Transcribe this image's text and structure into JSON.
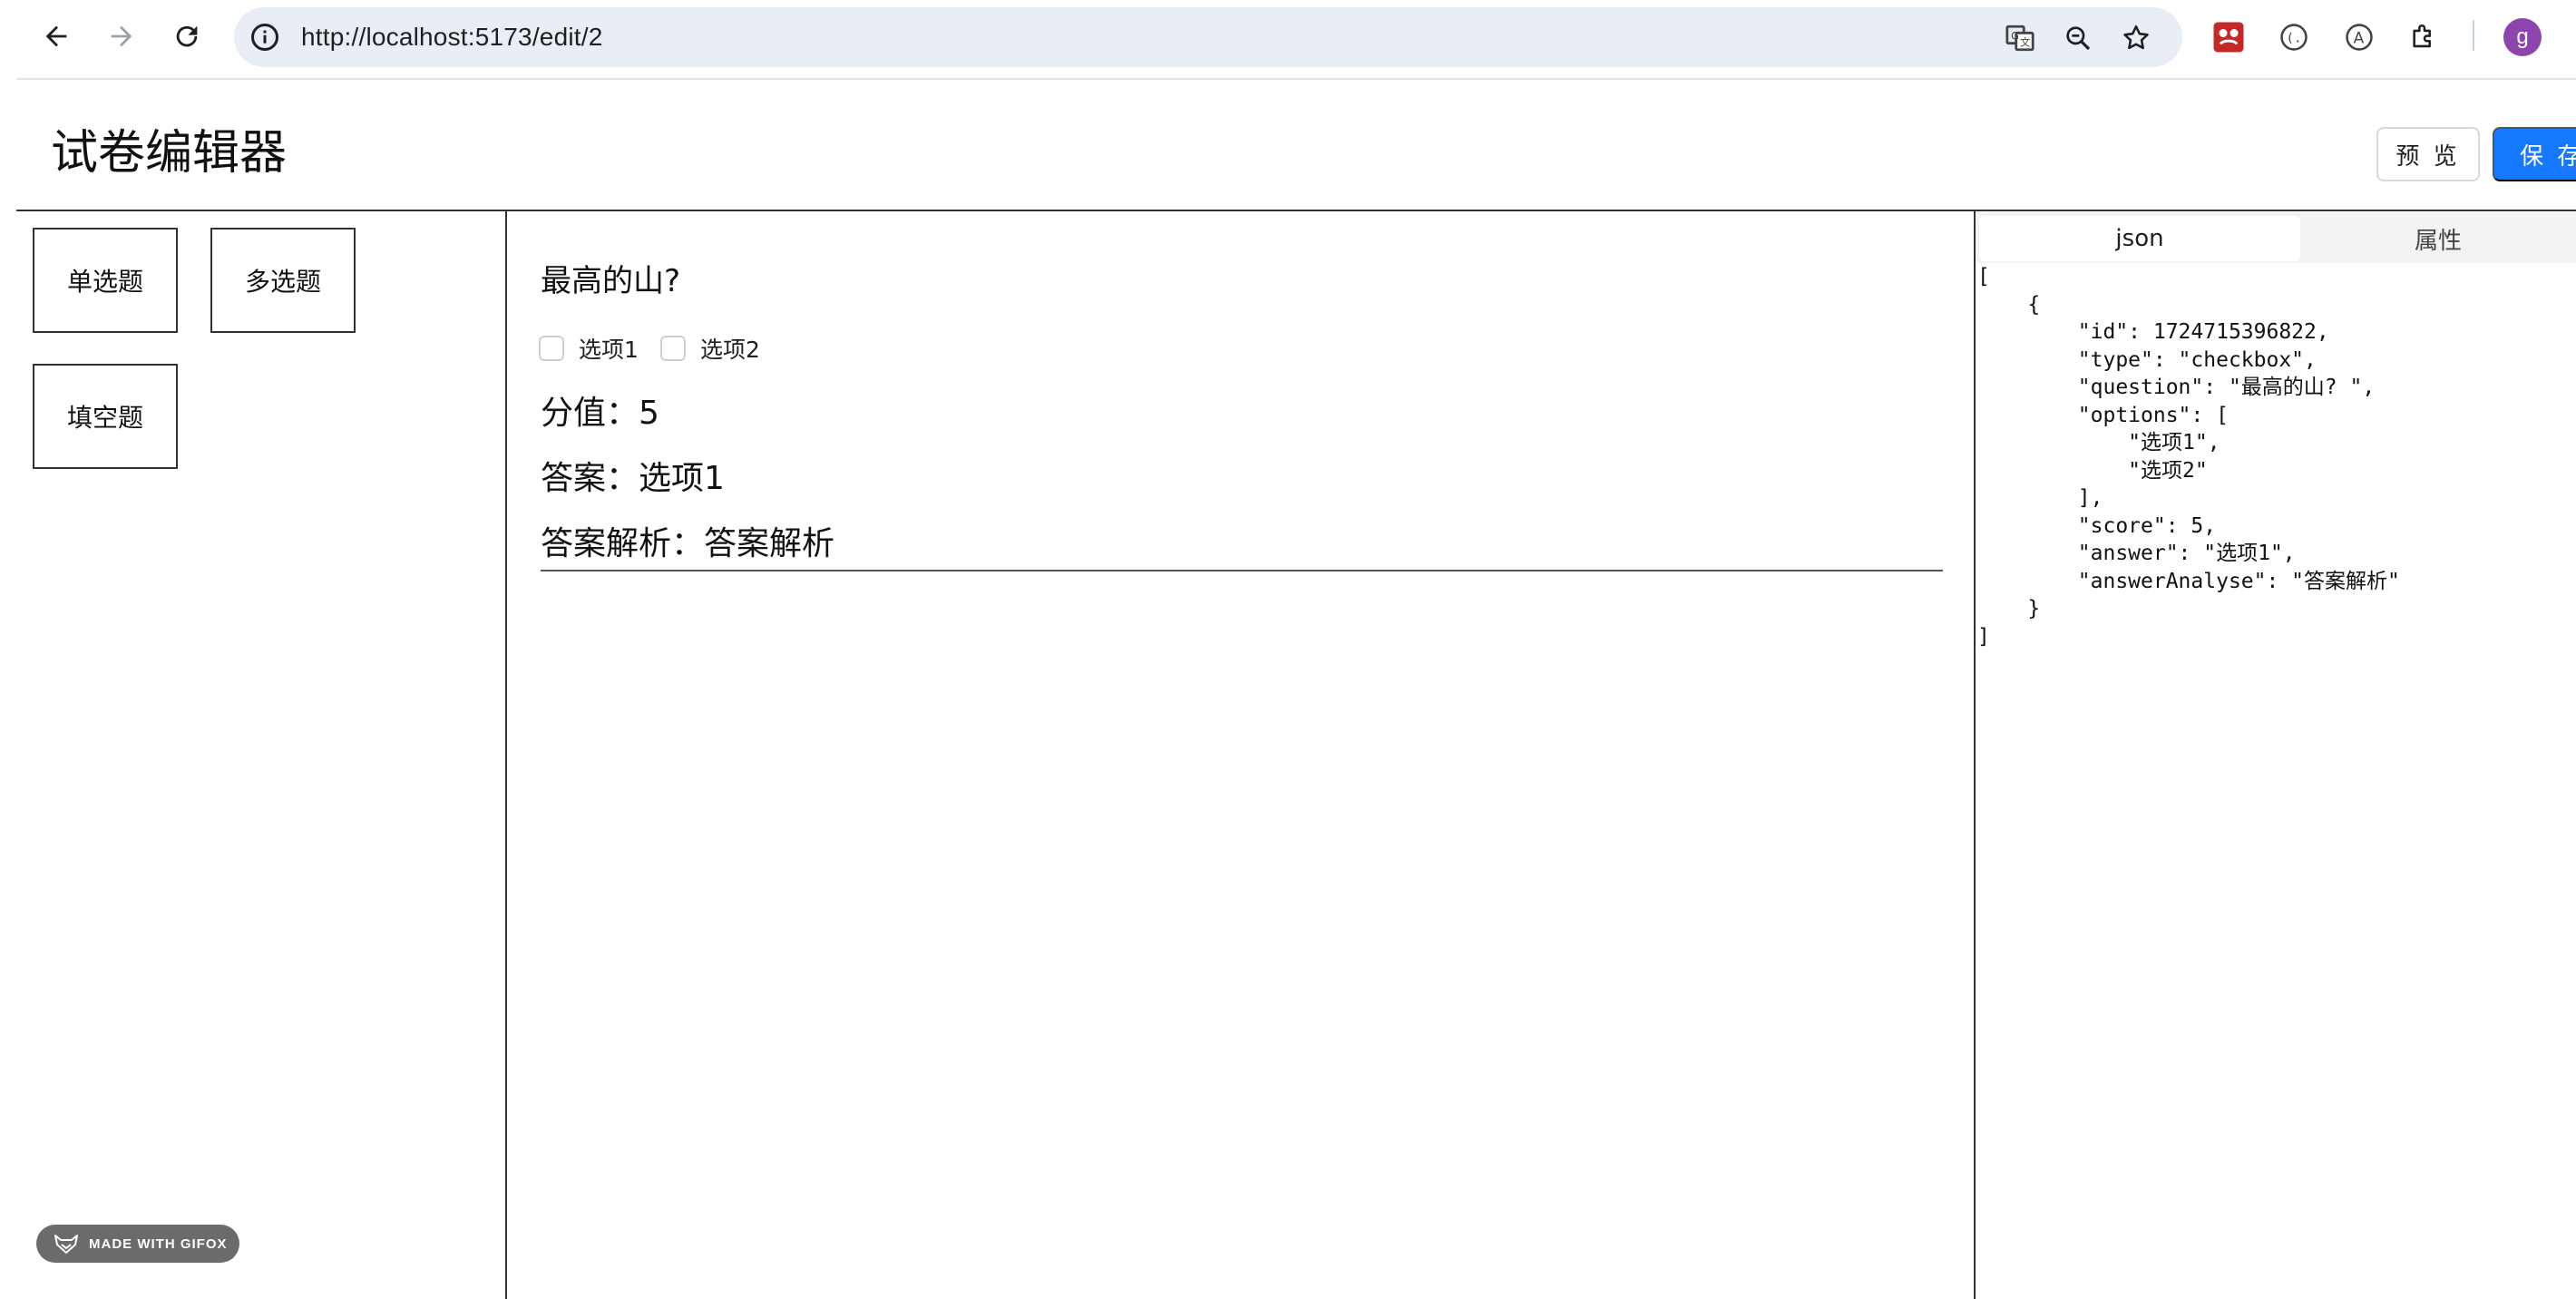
{
  "browser": {
    "url": "http://localhost:5173/edit/2",
    "avatar_letter": "g",
    "accent": "#1677ff"
  },
  "header": {
    "title": "试卷编辑器",
    "preview_label": "预 览",
    "save_label": "保 存"
  },
  "question_types": [
    {
      "label": "单选题"
    },
    {
      "label": "多选题"
    },
    {
      "label": "填空题"
    }
  ],
  "question": {
    "title": "最高的山?",
    "options": [
      "选项1",
      "选项2"
    ],
    "score_text": "分值：5",
    "answer_text": "答案：选项1",
    "analysis_text": "答案解析：答案解析"
  },
  "right_panel": {
    "tabs": [
      {
        "label": "json",
        "active": true
      },
      {
        "label": "属性",
        "active": false
      }
    ],
    "json_text": "[\n    {\n        \"id\": 1724715396822,\n        \"type\": \"checkbox\",\n        \"question\": \"最高的山? \",\n        \"options\": [\n            \"选项1\",\n            \"选项2\"\n        ],\n        \"score\": 5,\n        \"answer\": \"选项1\",\n        \"answerAnalyse\": \"答案解析\"\n    }\n]"
  },
  "badge": {
    "text": "MADE WITH GIFOX"
  }
}
